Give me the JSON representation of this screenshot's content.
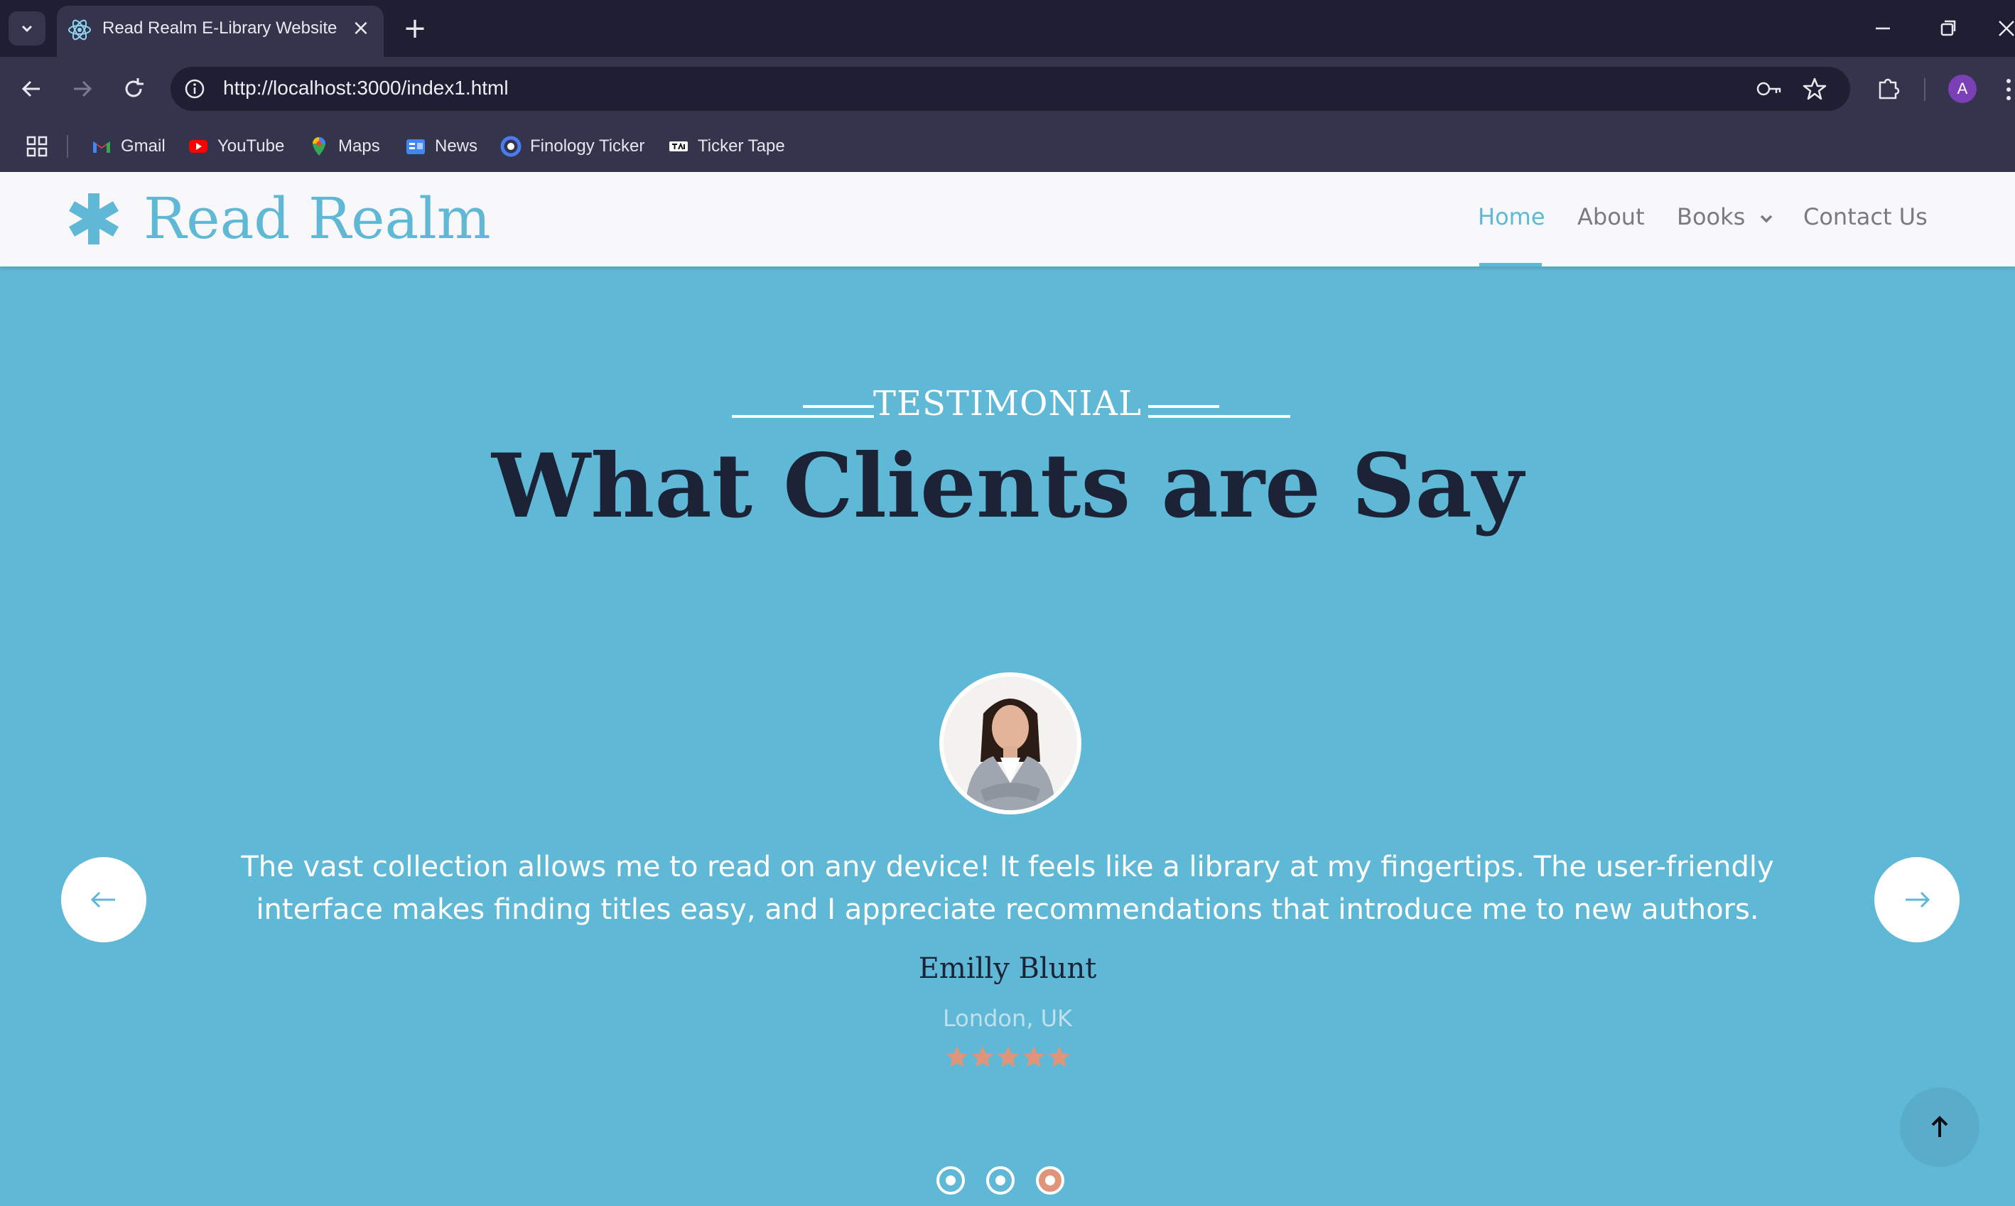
{
  "browser": {
    "tab_title": "Read Realm E-Library Website",
    "url": "http://localhost:3000/index1.html",
    "profile_initial": "A",
    "bookmarks": [
      {
        "label": "Gmail",
        "icon": "gmail-icon"
      },
      {
        "label": "YouTube",
        "icon": "youtube-icon"
      },
      {
        "label": "Maps",
        "icon": "maps-icon"
      },
      {
        "label": "News",
        "icon": "news-icon"
      },
      {
        "label": "Finology Ticker",
        "icon": "finology-icon"
      },
      {
        "label": "Ticker Tape",
        "icon": "tickertape-icon"
      }
    ]
  },
  "site": {
    "brand": "Read Realm",
    "nav": [
      {
        "label": "Home",
        "active": true
      },
      {
        "label": "About"
      },
      {
        "label": "Books",
        "has_dropdown": true
      },
      {
        "label": "Contact Us"
      }
    ]
  },
  "testimonial": {
    "eyebrow": "TESTIMONIAL",
    "headline": "What Clients are Say",
    "quote": "The vast collection allows me to read on any device! It feels like a library at my fingertips. The user-friendly interface makes finding titles easy, and I appreciate recommendations that introduce me to new authors.",
    "name": "Emilly Blunt",
    "location": "London, UK",
    "rating": 5,
    "slides": 3,
    "active_slide": 3
  },
  "colors": {
    "accent": "#5fb8d6",
    "headline": "#1c2336",
    "star": "#e0957a",
    "active_dot": "#e0957a"
  }
}
